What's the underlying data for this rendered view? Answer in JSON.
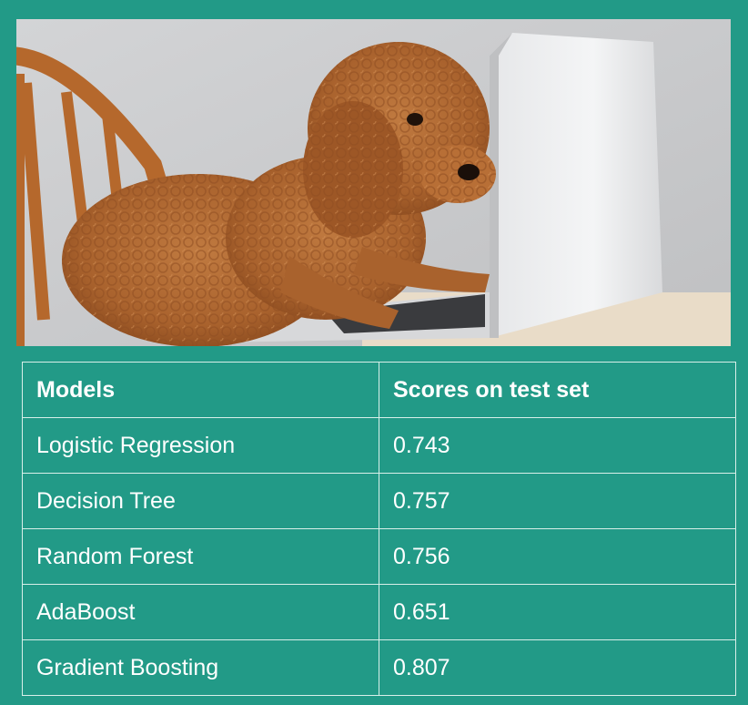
{
  "photo": {
    "description_icon": "poodle-at-laptop-photo"
  },
  "table": {
    "headers": [
      "Models",
      "Scores on test set"
    ],
    "rows": [
      [
        "Logistic Regression",
        "0.743"
      ],
      [
        "Decision Tree",
        "0.757"
      ],
      [
        "Random Forest",
        "0.756"
      ],
      [
        "AdaBoost",
        "0.651"
      ],
      [
        "Gradient Boosting",
        "0.807"
      ]
    ]
  },
  "colors": {
    "background": "#229a87",
    "text": "#ffffff",
    "grid": "#d8efe9"
  }
}
